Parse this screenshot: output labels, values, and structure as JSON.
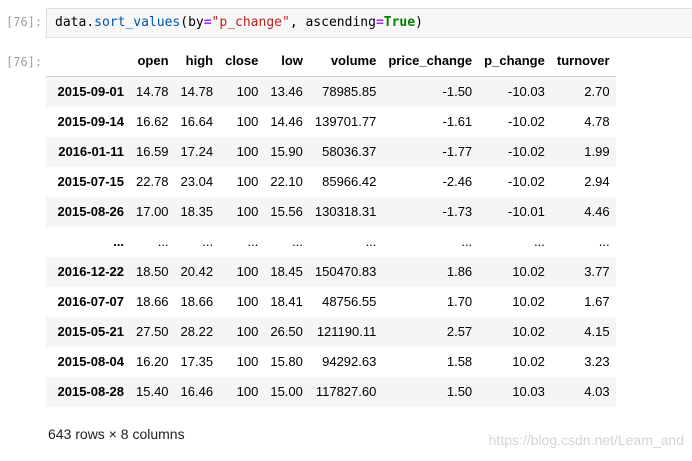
{
  "input_prompt": "[76]:",
  "output_prompt": "[76]:",
  "code": {
    "object": "data",
    "dot": ".",
    "method": "sort_values",
    "open_paren": "(",
    "param1": "by",
    "eq1": "=",
    "arg1": "\"p_change\"",
    "comma": ", ",
    "param2": "ascending",
    "eq2": "=",
    "arg2": "True",
    "close_paren": ")"
  },
  "table": {
    "index_header": "",
    "columns": [
      "open",
      "high",
      "close",
      "low",
      "volume",
      "price_change",
      "p_change",
      "turnover"
    ],
    "rows": [
      {
        "index": "2015-09-01",
        "cells": [
          "14.78",
          "14.78",
          "100",
          "13.46",
          "78985.85",
          "-1.50",
          "-10.03",
          "2.70"
        ]
      },
      {
        "index": "2015-09-14",
        "cells": [
          "16.62",
          "16.64",
          "100",
          "14.46",
          "139701.77",
          "-1.61",
          "-10.02",
          "4.78"
        ]
      },
      {
        "index": "2016-01-11",
        "cells": [
          "16.59",
          "17.24",
          "100",
          "15.90",
          "58036.37",
          "-1.77",
          "-10.02",
          "1.99"
        ]
      },
      {
        "index": "2015-07-15",
        "cells": [
          "22.78",
          "23.04",
          "100",
          "22.10",
          "85966.42",
          "-2.46",
          "-10.02",
          "2.94"
        ]
      },
      {
        "index": "2015-08-26",
        "cells": [
          "17.00",
          "18.35",
          "100",
          "15.56",
          "130318.31",
          "-1.73",
          "-10.01",
          "4.46"
        ]
      },
      {
        "index": "...",
        "cells": [
          "...",
          "...",
          "...",
          "...",
          "...",
          "...",
          "...",
          "..."
        ]
      },
      {
        "index": "2016-12-22",
        "cells": [
          "18.50",
          "20.42",
          "100",
          "18.45",
          "150470.83",
          "1.86",
          "10.02",
          "3.77"
        ]
      },
      {
        "index": "2016-07-07",
        "cells": [
          "18.66",
          "18.66",
          "100",
          "18.41",
          "48756.55",
          "1.70",
          "10.02",
          "1.67"
        ]
      },
      {
        "index": "2015-05-21",
        "cells": [
          "27.50",
          "28.22",
          "100",
          "26.50",
          "121190.11",
          "2.57",
          "10.02",
          "4.15"
        ]
      },
      {
        "index": "2015-08-04",
        "cells": [
          "16.20",
          "17.35",
          "100",
          "15.80",
          "94292.63",
          "1.58",
          "10.02",
          "3.23"
        ]
      },
      {
        "index": "2015-08-28",
        "cells": [
          "15.40",
          "16.46",
          "100",
          "15.00",
          "117827.60",
          "1.50",
          "10.03",
          "4.03"
        ]
      }
    ]
  },
  "shape_text": "643 rows × 8 columns",
  "watermark": "https://blog.csdn.net/Leam_and"
}
